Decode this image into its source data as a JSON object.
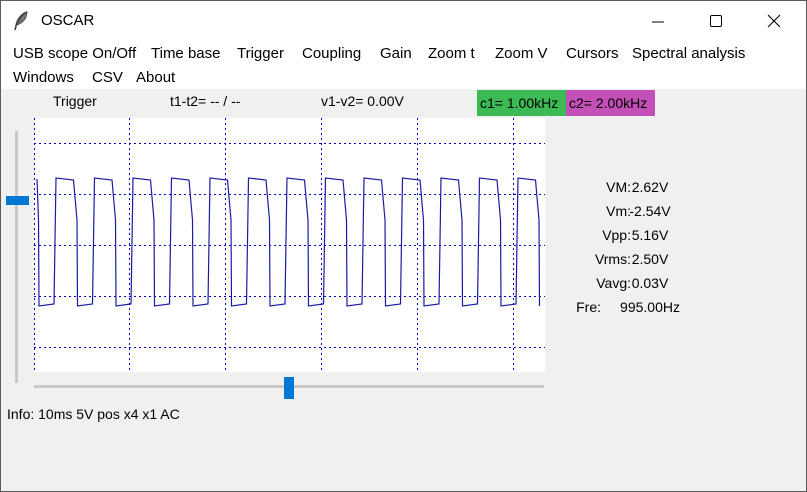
{
  "window": {
    "title": "OSCAR"
  },
  "menu": {
    "row1": [
      "USB scope On/Off",
      "Time base",
      "Trigger",
      "Coupling",
      "Gain",
      "Zoom t",
      "Zoom V",
      "Cursors",
      "Spectral analysis"
    ],
    "row2": [
      "Windows",
      "CSV",
      "About"
    ]
  },
  "status": {
    "trigger": "Trigger",
    "time_delta": "t1-t2= -- / --",
    "volt_delta": "v1-v2= 0.00V",
    "c1": "c1=  1.00kHz",
    "c2": "c2=  2.00kHz"
  },
  "colors": {
    "c1_bg": "#3cba54",
    "c2_bg": "#c44fb6",
    "trace": "#1a1aa8",
    "grid": "#0000c0",
    "accent": "#0078d4"
  },
  "measurements": [
    {
      "label": "VM:",
      "value": "2.62V"
    },
    {
      "label": "Vm:",
      "value": "-2.54V"
    },
    {
      "label": "Vpp:",
      "value": "5.16V"
    },
    {
      "label": "Vrms:",
      "value": "2.50V"
    },
    {
      "label": "Vavg:",
      "value": "0.03V"
    },
    {
      "label": "Fre:",
      "value": "995.00Hz"
    }
  ],
  "info": "Info:  10ms 5V pos x4 x1 AC",
  "icons": {
    "app": "feather-icon",
    "minimize": "minimize-icon",
    "maximize": "maximize-icon",
    "close": "close-icon"
  }
}
